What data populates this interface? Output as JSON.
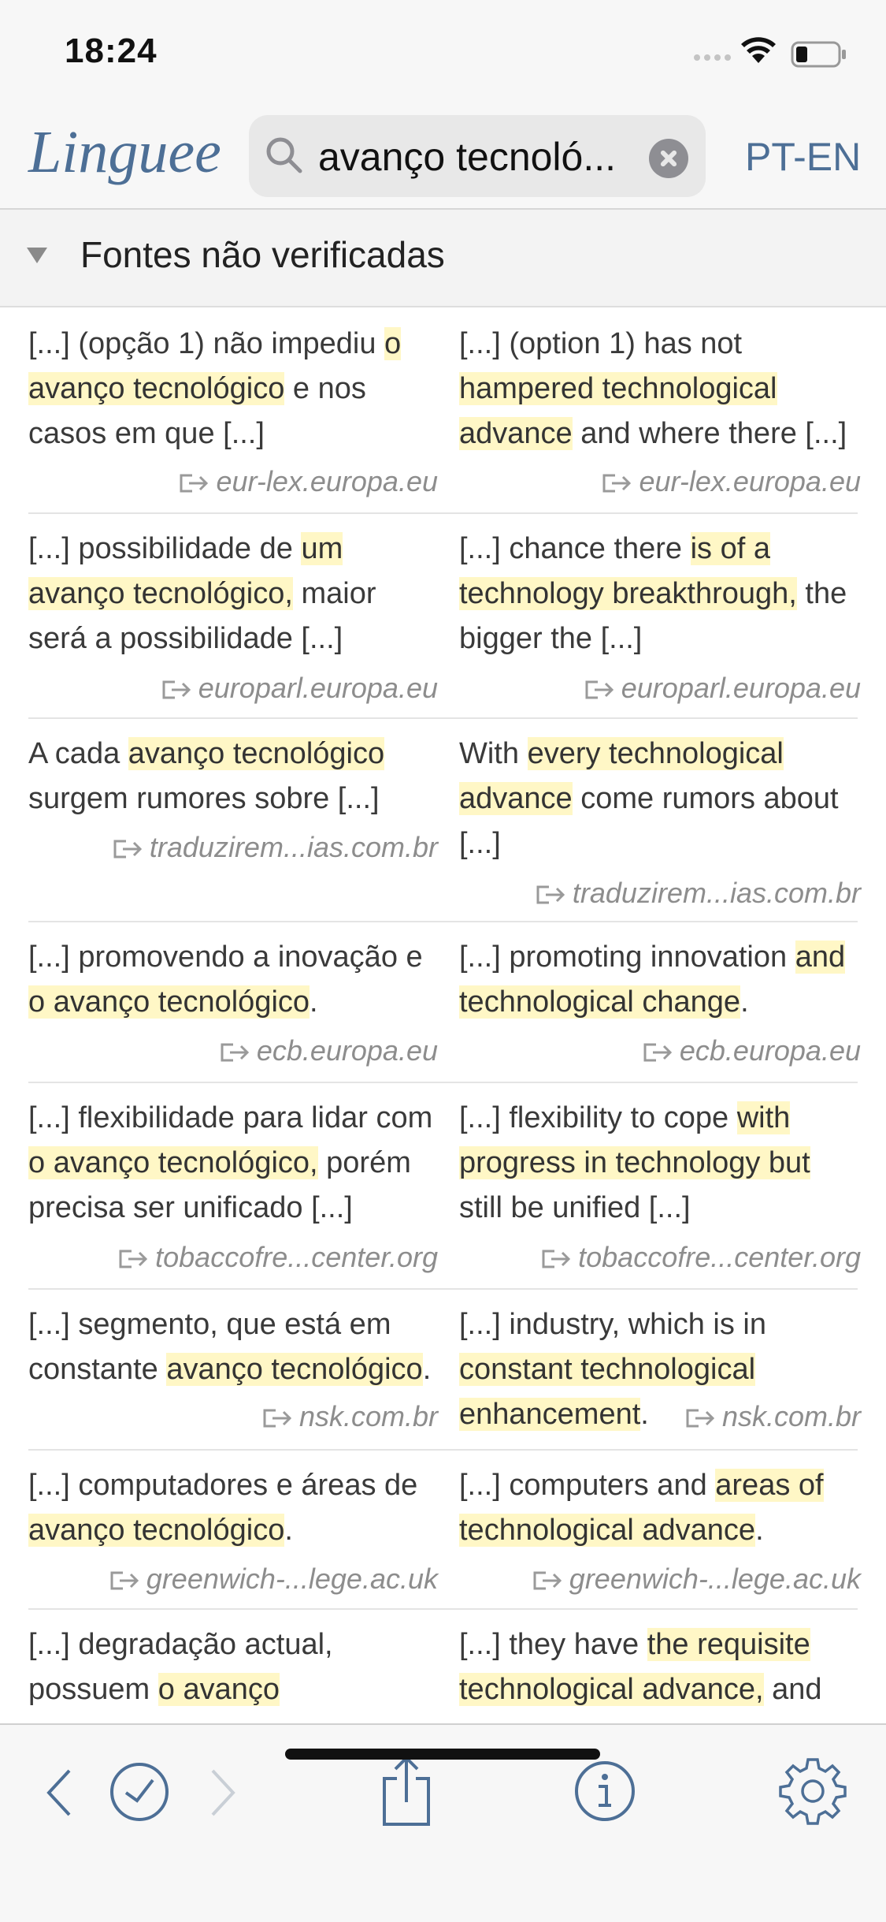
{
  "status": {
    "time": "18:24"
  },
  "header": {
    "logo": "Linguee",
    "search_value": "avanço tecnoló...",
    "language_pair": "PT-EN"
  },
  "section": {
    "title": "Fontes não verificadas"
  },
  "results": [
    {
      "pt": [
        [
          "[...] (opção 1) não impediu ",
          false
        ],
        [
          "o avanço tecnológico",
          true
        ],
        [
          " e nos casos em que [...]",
          false
        ]
      ],
      "en": [
        [
          "[...] (option 1) has not ",
          false
        ],
        [
          "hampered technological advance",
          true
        ],
        [
          " and where there [...]",
          false
        ]
      ],
      "source_pt": "eur-lex.europa.eu",
      "source_en": "eur-lex.europa.eu"
    },
    {
      "pt": [
        [
          "[...] possibilidade de ",
          false
        ],
        [
          "um avanço tecnológico,",
          true
        ],
        [
          " maior será a possibilidade [...]",
          false
        ]
      ],
      "en": [
        [
          "[...] chance there ",
          false
        ],
        [
          "is of a technology breakthrough,",
          true
        ],
        [
          " the bigger the [...]",
          false
        ]
      ],
      "source_pt": "europarl.europa.eu",
      "source_en": "europarl.europa.eu"
    },
    {
      "pt": [
        [
          "A cada ",
          false
        ],
        [
          "avanço tecnológico",
          true
        ],
        [
          " surgem rumores sobre [...]",
          false
        ]
      ],
      "en": [
        [
          "With ",
          false
        ],
        [
          "every technological advance",
          true
        ],
        [
          " come rumors about [...]",
          false
        ]
      ],
      "source_pt": "traduzirem...ias.com.br",
      "source_en": "traduzirem...ias.com.br"
    },
    {
      "pt": [
        [
          "[...] promovendo a inovação e ",
          false
        ],
        [
          "o avanço tecnológico",
          true
        ],
        [
          ".",
          false
        ]
      ],
      "en": [
        [
          "[...] promoting innovation ",
          false
        ],
        [
          "and technological change",
          true
        ],
        [
          ".",
          false
        ]
      ],
      "source_pt": "ecb.europa.eu",
      "source_en": "ecb.europa.eu"
    },
    {
      "pt": [
        [
          "[...] flexibilidade para lidar com ",
          false
        ],
        [
          "o avanço tecnológico,",
          true
        ],
        [
          " porém precisa ser unificado [...]",
          false
        ]
      ],
      "en": [
        [
          "[...] flexibility to cope ",
          false
        ],
        [
          "with progress in technology but",
          true
        ],
        [
          " still be unified [...]",
          false
        ]
      ],
      "source_pt": "tobaccofre...center.org",
      "source_en": "tobaccofre...center.org"
    },
    {
      "pt": [
        [
          "[...] segmento, que está em constante ",
          false
        ],
        [
          "avanço tecnológico",
          true
        ],
        [
          ".",
          false
        ]
      ],
      "en": [
        [
          "[...] industry, which is in ",
          false
        ],
        [
          "constant technological enhancement",
          true
        ],
        [
          ".",
          false
        ]
      ],
      "source_pt": "nsk.com.br",
      "source_en": "nsk.com.br"
    },
    {
      "pt": [
        [
          "[...] computadores e áreas de ",
          false
        ],
        [
          "avanço tecnológico",
          true
        ],
        [
          ".",
          false
        ]
      ],
      "en": [
        [
          "[...] computers and ",
          false
        ],
        [
          "areas of technological advance",
          true
        ],
        [
          ".",
          false
        ]
      ],
      "source_pt": "greenwich-...lege.ac.uk",
      "source_en": "greenwich-...lege.ac.uk"
    },
    {
      "pt": [
        [
          "[...] degradação actual, possuem ",
          false
        ],
        [
          "o avanço",
          true
        ],
        [
          "",
          false
        ]
      ],
      "en": [
        [
          "[...] they have ",
          false
        ],
        [
          "the requisite technological advance,",
          true
        ],
        [
          " and",
          false
        ]
      ],
      "source_pt": "",
      "source_en": ""
    }
  ],
  "icons": {
    "back": "chevron-left-icon",
    "history": "clock-icon",
    "forward": "chevron-right-icon",
    "share": "share-icon",
    "info": "info-icon",
    "settings": "gear-icon"
  },
  "colors": {
    "accent": "#4d6f96",
    "highlight": "#fff7c6"
  }
}
